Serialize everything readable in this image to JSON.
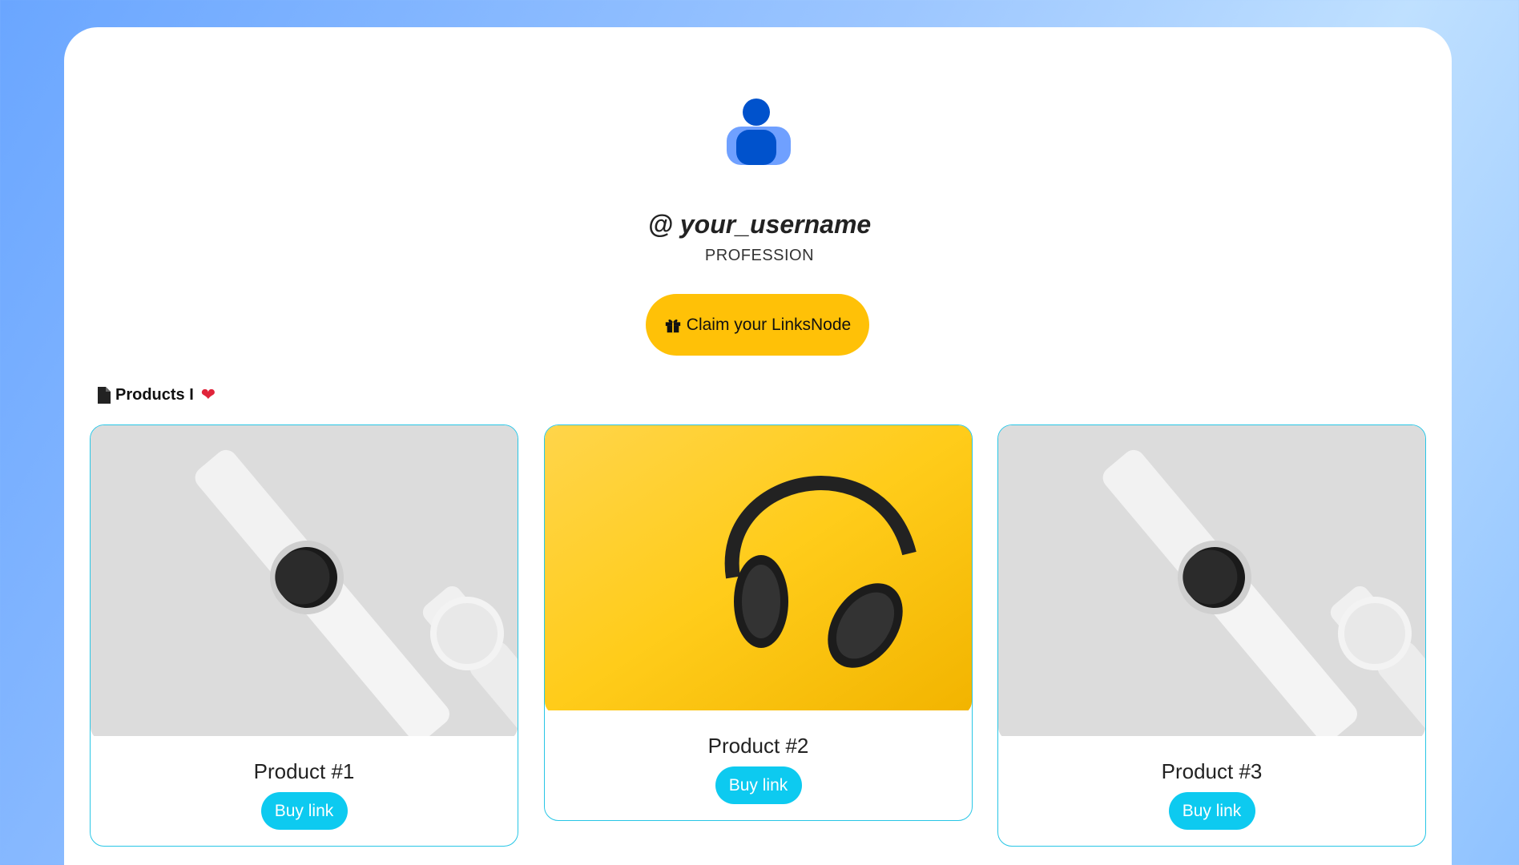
{
  "profile": {
    "username": "@ your_username",
    "profession": "PROFESSION",
    "claim_button": "Claim your LinksNode"
  },
  "section": {
    "title": "Products I",
    "emoji": "❤"
  },
  "products": [
    {
      "name": "Product #1",
      "buy_label": "Buy link",
      "image": "white-smartwatch"
    },
    {
      "name": "Product #2",
      "buy_label": "Buy link",
      "image": "black-headphones-on-yellow"
    },
    {
      "name": "Product #3",
      "buy_label": "Buy link",
      "image": "white-smartwatch"
    }
  ],
  "colors": {
    "accent_yellow": "#ffc107",
    "accent_cyan": "#0dcaf0",
    "card_border": "#28c6e6",
    "avatar_blue": "#0052cc"
  }
}
